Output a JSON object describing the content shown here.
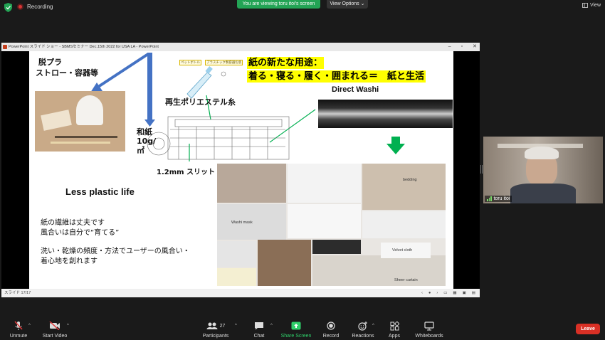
{
  "topbar": {
    "recording_label": "Recording",
    "viewing_banner": "You are viewing toru itoi's screen",
    "view_options_label": "View Options",
    "view_label": "View"
  },
  "shared_window": {
    "title": "PowerPoint スライド ショー - SBMSセミナー Dec.15th 2022 for USA LA - PowerPoint",
    "status_left": "スライド 17/17"
  },
  "slide": {
    "datsupura": "脱プラ",
    "straw_text": "ストロー・容器等",
    "headline_line1": "紙の新たな用途：",
    "headline_line2": "着る・寝る・履く・囲まれる＝　紙と生活",
    "bottle_label": "ペットボトル",
    "plastic_label": "プラスチック製容器包装",
    "recycled_text": "再生ポリエステル糸",
    "direct_washi": "Direct Washi",
    "washi_weight": "和紙10g/㎡",
    "slit_text": "1.2mm スリット",
    "less_plastic": "Less plastic life",
    "body_line1": "紙の繊維は丈夫です",
    "body_line2": "風合いは自分で“育てる”",
    "body_line3": "洗い・乾燥の頻度・方法でユーザーの風合い・",
    "body_line4": "着心地を創れます",
    "captions": {
      "bedding": "bedding",
      "washi_mask": "Washi mask",
      "velvet_cloth": "Velvet cloth",
      "sheer_curtain": "Sheer curtain"
    }
  },
  "participant": {
    "name": "toru itoi"
  },
  "toolbar": {
    "unmute": "Unmute",
    "start_video": "Start Video",
    "participants": "Participants",
    "participants_count": "27",
    "chat": "Chat",
    "share_screen": "Share Screen",
    "record": "Record",
    "reactions": "Reactions",
    "apps": "Apps",
    "whiteboards": "Whiteboards",
    "leave": "Leave"
  },
  "colors": {
    "share_green": "#2fcf6a",
    "leave_red": "#d93025",
    "highlight_yellow": "#ffff00",
    "arrow_blue": "#4472c4",
    "arrow_green": "#00b050"
  }
}
